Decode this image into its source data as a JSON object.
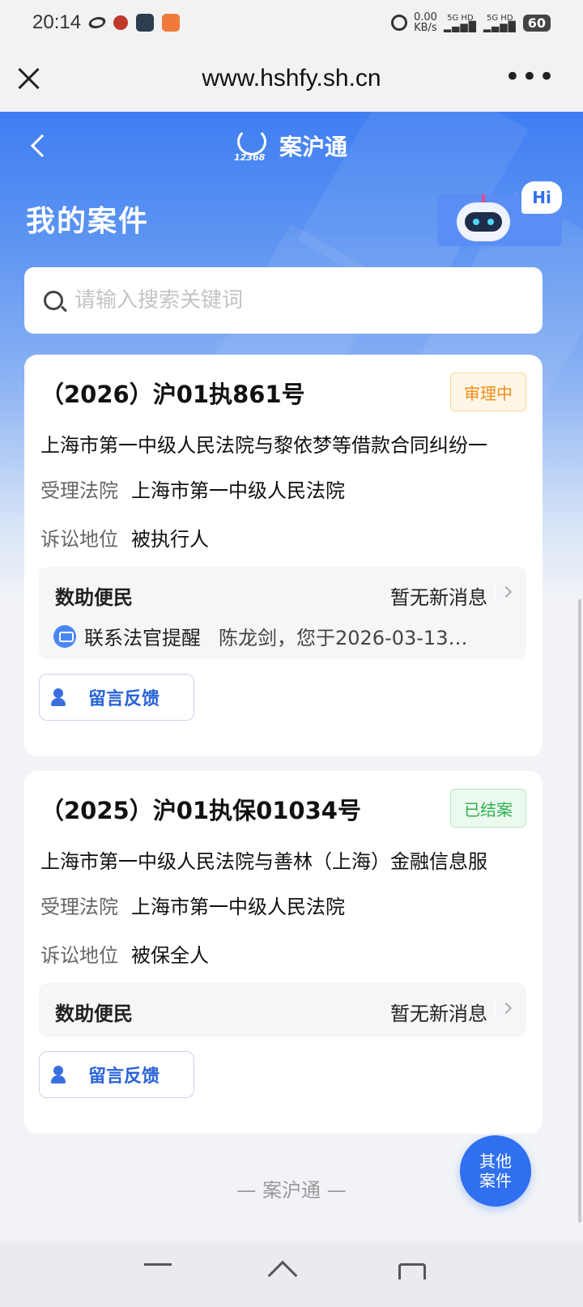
{
  "status_bar": {
    "time": "20:14",
    "net_speed_value": "0.00",
    "net_speed_unit": "KB/s",
    "signal1": "5G HD",
    "signal2": "5G HD",
    "battery": "60"
  },
  "browser": {
    "url": "www.hshfy.sh.cn"
  },
  "header": {
    "brand_name": "案沪通",
    "brand_number": "12368",
    "page_title": "我的案件",
    "hi_label": "Hi"
  },
  "search": {
    "placeholder": "请输入搜索关键词"
  },
  "cases": [
    {
      "case_no": "（2026）沪01执861号",
      "status": "审理中",
      "title": "上海市第一中级人民法院与黎依梦等借款合同纠纷一",
      "court_label": "受理法院",
      "court": "上海市第一中级人民法院",
      "role_label": "诉讼地位",
      "role": "被执行人",
      "help_title": "数助便民",
      "help_status": "暂无新消息",
      "msg_label": "联系法官提醒",
      "msg_text": "陈龙剑，您于2026-03-13…",
      "feedback_label": "留言反馈"
    },
    {
      "case_no": "（2025）沪01执保01034号",
      "status": "已结案",
      "title": "上海市第一中级人民法院与善林（上海）金融信息服",
      "court_label": "受理法院",
      "court": "上海市第一中级人民法院",
      "role_label": "诉讼地位",
      "role": "被保全人",
      "help_title": "数助便民",
      "help_status": "暂无新消息",
      "feedback_label": "留言反馈"
    }
  ],
  "footer": {
    "brand": "— 案沪通 —",
    "fab_line1": "其他",
    "fab_line2": "案件"
  },
  "colors": {
    "primary": "#2f6ff0",
    "processing": "#f08c1a",
    "closed": "#2fb350"
  }
}
